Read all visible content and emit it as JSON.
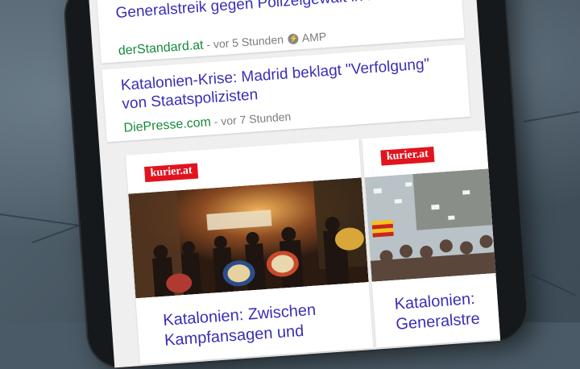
{
  "feed": {
    "items": [
      {
        "headline": "Generalstreik gegen Polizeigewalt in Katalonien",
        "source": "derStandard.at",
        "time": " - vor 5 Stunden",
        "amp_label": "AMP"
      },
      {
        "headline": "Katalonien-Krise: Madrid beklagt \"Verfolgung\" von Staatspolizisten",
        "source": "DiePresse.com",
        "time": " - vor 7 Stunden"
      }
    ],
    "stories": [
      {
        "logo": "kurier.at",
        "title": "Katalonien: Zwischen Kampfansagen und"
      },
      {
        "logo": "kurier.at",
        "title": "Katalonien: Generalstre"
      }
    ]
  },
  "colors": {
    "headline": "#3a2fb5",
    "source": "#178a3c",
    "meta": "#7c7c7c",
    "logo_bg": "#e1141e",
    "screen_bg": "#efefef"
  },
  "icons": [
    "amp-icon"
  ]
}
